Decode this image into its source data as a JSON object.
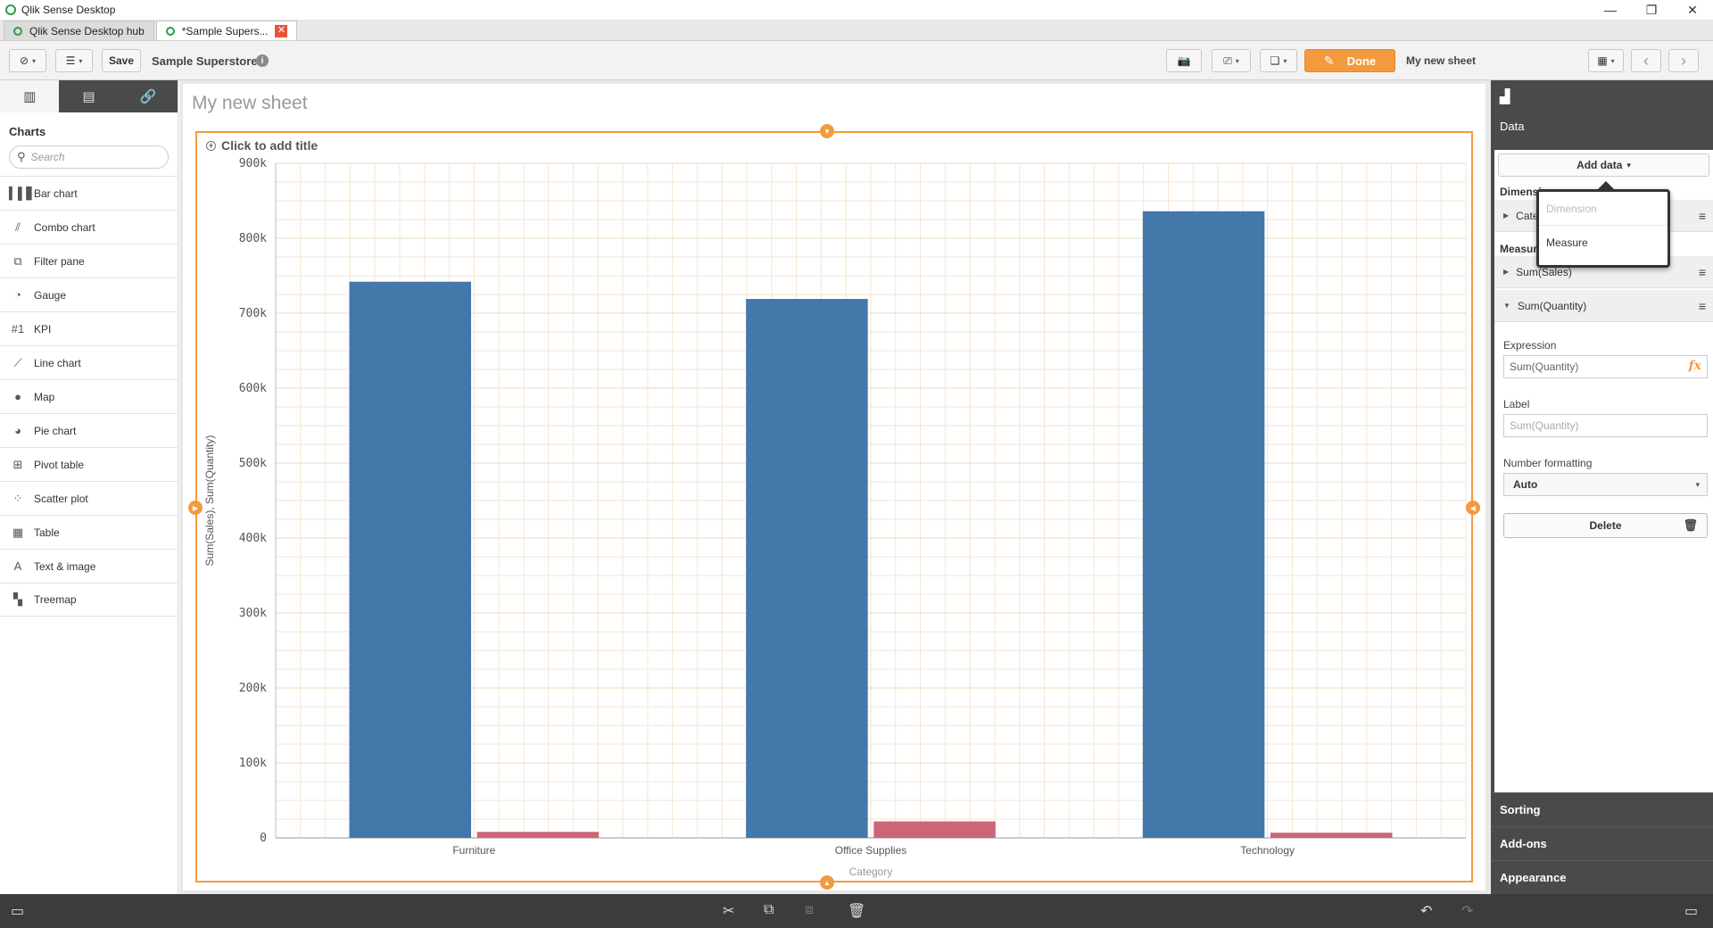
{
  "window": {
    "title": "Qlik Sense Desktop",
    "minimize": "—",
    "restore": "❐",
    "close": "✕"
  },
  "tabs": [
    {
      "label": "Qlik Sense Desktop hub"
    },
    {
      "label": "*Sample Supers...",
      "close": "✕"
    }
  ],
  "toolbar": {
    "nav_icon": "⊘",
    "list_icon": "☰",
    "caret": "▾",
    "save_label": "Save",
    "app_name": "Sample Superstore",
    "info_icon": "i",
    "camera_icon": "📷",
    "present_icon": "⎚",
    "bookmark_icon": "❏",
    "done_label": "Done",
    "pencil_icon": "✎",
    "sheet_name": "My new sheet",
    "sheets_icon": "▦",
    "prev_icon": "‹",
    "next_icon": "›"
  },
  "left_panel": {
    "tab_icons": [
      "▥",
      "▤",
      "🔗"
    ],
    "heading": "Charts",
    "search_placeholder": "Search",
    "search_icon": "⚲",
    "items": [
      {
        "label": "Bar chart",
        "icon": "▍▌▋",
        "icon_name": "bar-chart-icon"
      },
      {
        "label": "Combo chart",
        "icon": "⫽",
        "icon_name": "combo-chart-icon"
      },
      {
        "label": "Filter pane",
        "icon": "⧉",
        "icon_name": "filter-pane-icon"
      },
      {
        "label": "Gauge",
        "icon": "◔",
        "icon_name": "gauge-icon"
      },
      {
        "label": "KPI",
        "icon": "#1",
        "icon_name": "kpi-icon"
      },
      {
        "label": "Line chart",
        "icon": "⟋",
        "icon_name": "line-chart-icon"
      },
      {
        "label": "Map",
        "icon": "●",
        "icon_name": "map-icon"
      },
      {
        "label": "Pie chart",
        "icon": "◕",
        "icon_name": "pie-chart-icon"
      },
      {
        "label": "Pivot table",
        "icon": "⊞",
        "icon_name": "pivot-table-icon"
      },
      {
        "label": "Scatter plot",
        "icon": "⁘",
        "icon_name": "scatter-plot-icon"
      },
      {
        "label": "Table",
        "icon": "▦",
        "icon_name": "table-icon"
      },
      {
        "label": "Text & image",
        "icon": "A",
        "icon_name": "text-image-icon"
      },
      {
        "label": "Treemap",
        "icon": "▚",
        "icon_name": "treemap-icon"
      }
    ]
  },
  "sheet": {
    "title": "My new sheet",
    "chart_title_placeholder": "Click to add title",
    "plus_icon": "+"
  },
  "chart_data": {
    "type": "bar",
    "categories": [
      "Furniture",
      "Office Supplies",
      "Technology"
    ],
    "series": [
      {
        "name": "Sum(Sales)",
        "values": [
          742000,
          719000,
          836000
        ],
        "color": "#4477aa"
      },
      {
        "name": "Sum(Quantity)",
        "values": [
          8000,
          22000,
          6900
        ],
        "color": "#cc6677"
      }
    ],
    "xlabel": "Category",
    "ylabel": "Sum(Sales), Sum(Quantity)",
    "ylim": [
      0,
      900000
    ],
    "yticks": [
      {
        "value": 0,
        "label": "0"
      },
      {
        "value": 100000,
        "label": "100k"
      },
      {
        "value": 200000,
        "label": "200k"
      },
      {
        "value": 300000,
        "label": "300k"
      },
      {
        "value": 400000,
        "label": "400k"
      },
      {
        "value": 500000,
        "label": "500k"
      },
      {
        "value": 600000,
        "label": "600k"
      },
      {
        "value": 700000,
        "label": "700k"
      },
      {
        "value": 800000,
        "label": "800k"
      },
      {
        "value": 900000,
        "label": "900k"
      }
    ],
    "grid": true,
    "legend": "none"
  },
  "right_panel": {
    "header_icon": "▟",
    "data_label": "Data",
    "add_data_label": "Add data",
    "caret": "▾",
    "dimensions_title": "Dimensions",
    "dimension_row": "Category",
    "measures_title": "Measures",
    "measure_rows": [
      "Sum(Sales)",
      "Sum(Quantity)"
    ],
    "menu_icon": "≡",
    "expression_label": "Expression",
    "expression_value": "Sum(Quantity)",
    "fx_icon": "fx",
    "label_label": "Label",
    "label_placeholder": "Sum(Quantity)",
    "number_formatting_label": "Number formatting",
    "number_formatting_value": "Auto",
    "delete_label": "Delete",
    "trash_icon": "🗑",
    "sorting_label": "Sorting",
    "addons_label": "Add-ons",
    "appearance_label": "Appearance"
  },
  "popup": {
    "items": [
      "Dimension",
      "Measure"
    ]
  },
  "bottom_bar": {
    "left_icon": "▭",
    "cut_icon": "✂",
    "copy_icon": "⧉",
    "paste_icon": "⧈",
    "delete_icon": "🗑",
    "undo_icon": "↶",
    "redo_icon": "↷",
    "right_icon": "▭"
  }
}
